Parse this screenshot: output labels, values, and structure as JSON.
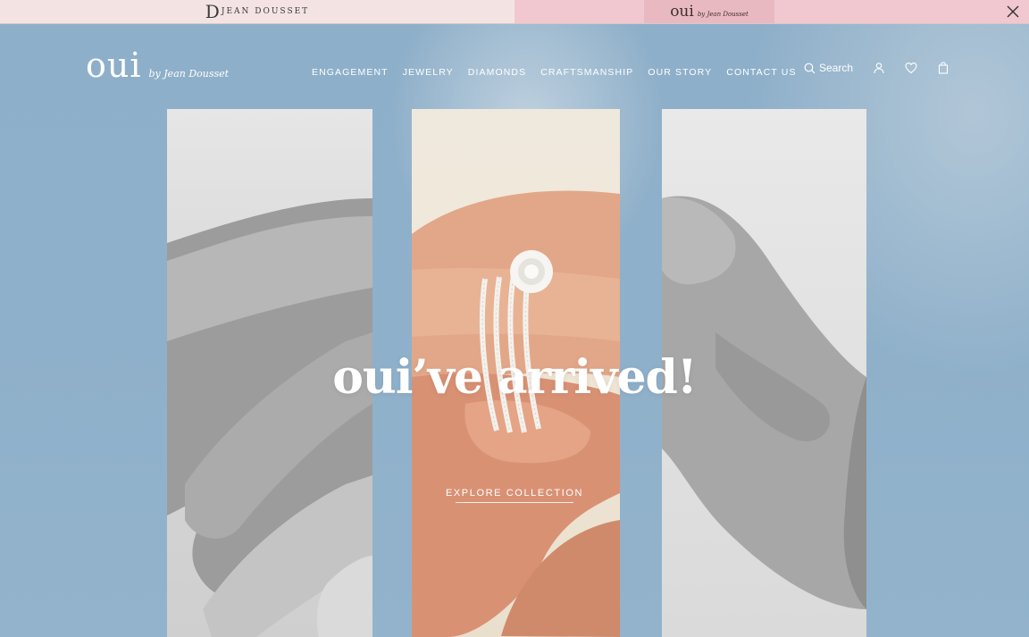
{
  "topbar": {
    "left_brand": {
      "initial": "D",
      "name": "JEAN DOUSSET"
    },
    "right_brand": {
      "word": "oui",
      "byline": "by Jean Dousset"
    }
  },
  "nav": {
    "logo": {
      "word": "oui",
      "byline": "by Jean Dousset"
    },
    "menu": [
      {
        "label": "ENGAGEMENT"
      },
      {
        "label": "JEWELRY"
      },
      {
        "label": "DIAMONDS"
      },
      {
        "label": "CRAFTSMANSHIP"
      },
      {
        "label": "OUR STORY"
      },
      {
        "label": "CONTACT US"
      }
    ],
    "search_label": "Search",
    "icons": [
      "search-icon",
      "account-icon",
      "heart-icon",
      "bag-icon",
      "close-icon"
    ]
  },
  "hero": {
    "headline": "oui’ve arrived!",
    "cta_label": "EXPLORE COLLECTION"
  },
  "colors": {
    "hero_blue": "#8fb0c9",
    "topbar_left": "#f3e4e3",
    "topbar_right": "#f1c8cf",
    "text_white": "#ffffff"
  }
}
